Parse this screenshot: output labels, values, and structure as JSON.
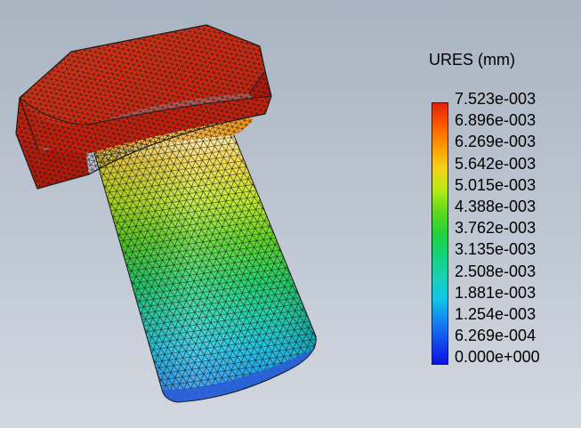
{
  "legend": {
    "title": "URES (mm)",
    "labels": [
      "7.523e-003",
      "6.896e-003",
      "6.269e-003",
      "5.642e-003",
      "5.015e-003",
      "4.388e-003",
      "3.762e-003",
      "3.135e-003",
      "2.508e-003",
      "1.881e-003",
      "1.254e-003",
      "6.269e-004",
      "0.000e+000"
    ],
    "colors": [
      "#e0220a",
      "#ff5a00",
      "#ff9b00",
      "#f3d21a",
      "#b6ea14",
      "#5ed81c",
      "#21d23c",
      "#14d27a",
      "#1ad0b6",
      "#10c6e6",
      "#1486ef",
      "#1248ee",
      "#0a12e0"
    ]
  },
  "colors": {
    "background_top": "#a9b4c2",
    "background_bottom": "#d3d8df",
    "mesh_line": "#1a1a1a"
  }
}
